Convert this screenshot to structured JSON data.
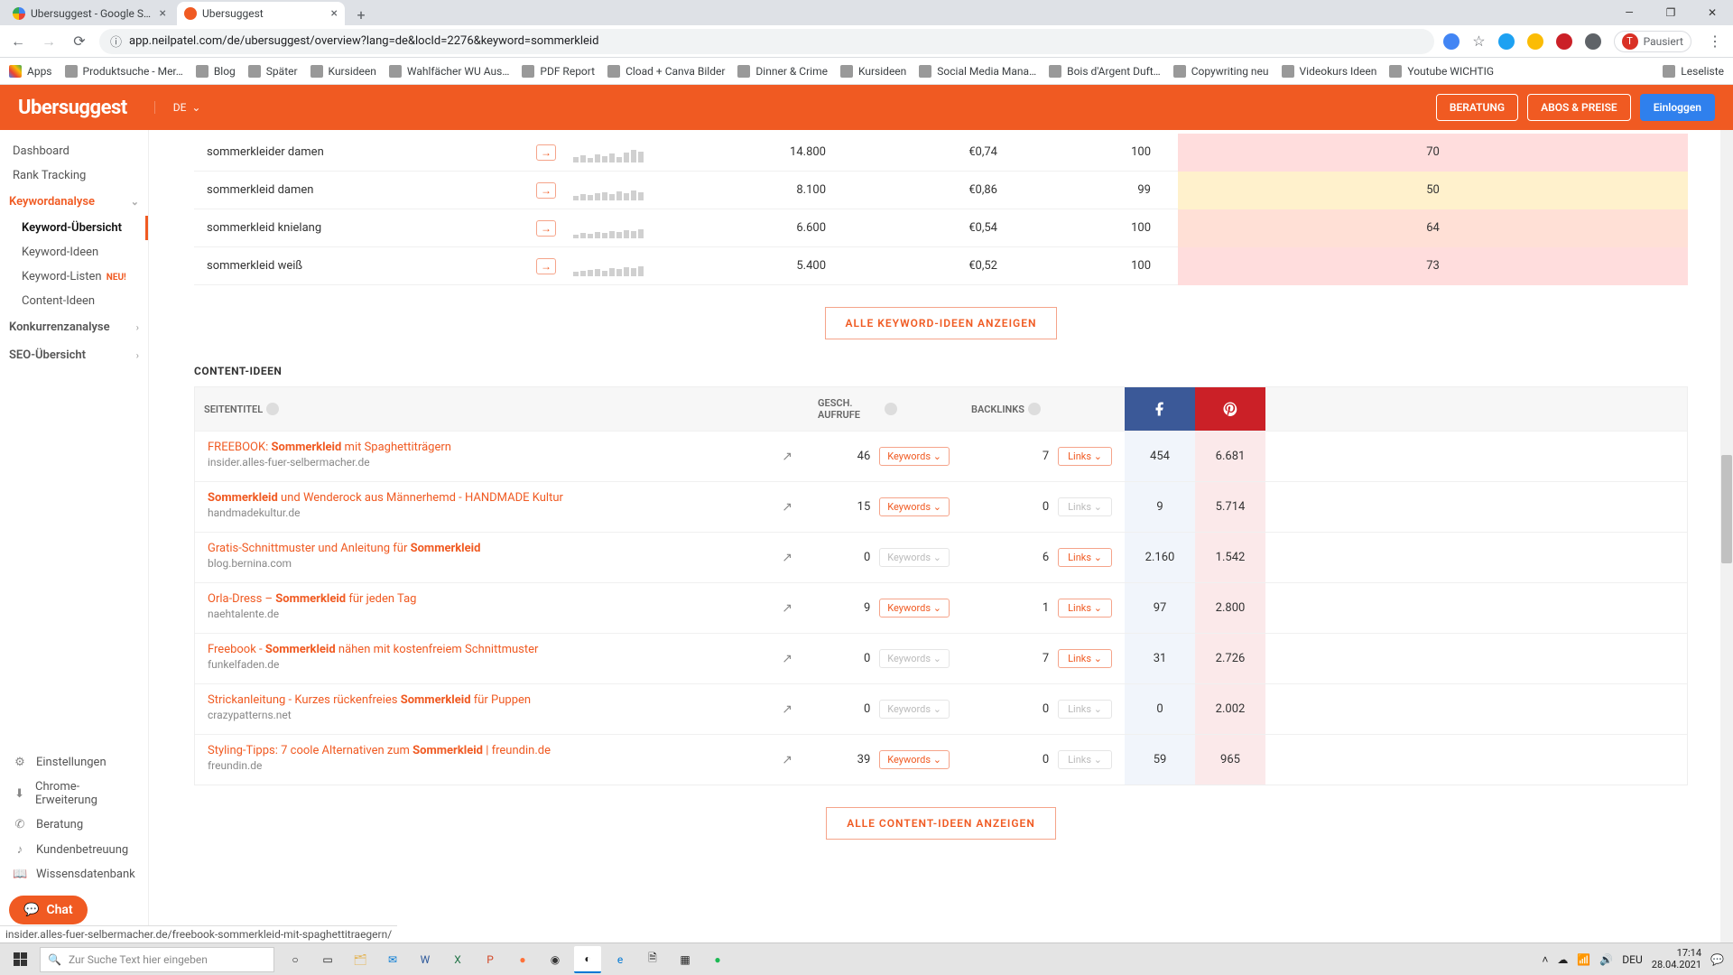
{
  "window": {
    "tabs": [
      {
        "title": "Ubersuggest - Google Suche"
      },
      {
        "title": "Ubersuggest"
      }
    ],
    "minimize": "—",
    "maximize": "❐",
    "close": "✕"
  },
  "address": {
    "lock": "ⓘ",
    "url": "app.neilpatel.com/de/ubersuggest/overview?lang=de&locId=2276&keyword=sommerkleid",
    "userpill": "Pausiert",
    "menu": "⋮"
  },
  "bookmarks": {
    "apps": "Apps",
    "items": [
      "Produktsuche - Mer…",
      "Blog",
      "Später",
      "Kursideen",
      "Wahlfächer WU Aus…",
      "PDF Report",
      "Cload + Canva Bilder",
      "Dinner & Crime",
      "Kursideen",
      "Social Media Mana…",
      "Bois d'Argent Duft…",
      "Copywriting neu",
      "Videokurs Ideen",
      "Youtube WICHTIG"
    ],
    "reading": "Leseliste"
  },
  "header": {
    "brand": "Ubersuggest",
    "lang": "DE",
    "consult": "BERATUNG",
    "plans": "ABOS & PREISE",
    "login": "Einloggen"
  },
  "sidebar": {
    "dashboard": "Dashboard",
    "rank": "Rank Tracking",
    "group_kw": "Keywordanalyse",
    "kw_overview": "Keyword-Übersicht",
    "kw_ideas": "Keyword-Ideen",
    "kw_lists": "Keyword-Listen",
    "kw_lists_tag": "NEU!",
    "content_ideas": "Content-Ideen",
    "group_comp": "Konkurrenzanalyse",
    "group_seo": "SEO-Übersicht",
    "settings": "Einstellungen",
    "chrome": "Chrome-Erweiterung",
    "consulting": "Beratung",
    "support": "Kundenbetreuung",
    "kb": "Wissensdatenbank",
    "chat": "Chat"
  },
  "keyword_ideas": {
    "rows": [
      {
        "kw": "sommerkleider damen",
        "vol": "14.800",
        "cpc": "€0,74",
        "pd": "100",
        "sd": "70",
        "sdclass": "sd-70"
      },
      {
        "kw": "sommerkleid damen",
        "vol": "8.100",
        "cpc": "€0,86",
        "pd": "99",
        "sd": "50",
        "sdclass": "sd-50"
      },
      {
        "kw": "sommerkleid knielang",
        "vol": "6.600",
        "cpc": "€0,54",
        "pd": "100",
        "sd": "64",
        "sdclass": "sd-64"
      },
      {
        "kw": "sommerkleid weiß",
        "vol": "5.400",
        "cpc": "€0,52",
        "pd": "100",
        "sd": "73",
        "sdclass": "sd-73"
      }
    ],
    "show_all": "ALLE KEYWORD-IDEEN ANZEIGEN"
  },
  "content_ideas": {
    "title": "CONTENT-IDEEN",
    "th_title": "SEITENTITEL",
    "th_visits": "GESCH. AUFRUFE",
    "th_backlinks": "BACKLINKS",
    "kw_label": "Keywords",
    "kw_chev": "⌄",
    "links_label": "Links",
    "links_chev": "⌄",
    "ext_icon": "↗",
    "rows": [
      {
        "pre": "FREEBOOK: ",
        "bold": "Sommerkleid",
        "post": " mit Spaghettiträgern",
        "domain": "insider.alles-fuer-selbermacher.de",
        "visits": "46",
        "kw_on": true,
        "backlinks": "7",
        "links_on": true,
        "fb": "454",
        "pin": "6.681"
      },
      {
        "pre": "",
        "bold": "Sommerkleid",
        "post": " und Wenderock aus Männerhemd - HANDMADE Kultur",
        "domain": "handmadekultur.de",
        "visits": "15",
        "kw_on": true,
        "backlinks": "0",
        "links_on": false,
        "fb": "9",
        "pin": "5.714"
      },
      {
        "pre": "Gratis-Schnittmuster und Anleitung für ",
        "bold": "Sommerkleid",
        "post": "",
        "domain": "blog.bernina.com",
        "visits": "0",
        "kw_on": false,
        "backlinks": "6",
        "links_on": true,
        "fb": "2.160",
        "pin": "1.542"
      },
      {
        "pre": "Orla-Dress – ",
        "bold": "Sommerkleid",
        "post": " für jeden Tag",
        "domain": "naehtalente.de",
        "visits": "9",
        "kw_on": true,
        "backlinks": "1",
        "links_on": true,
        "fb": "97",
        "pin": "2.800"
      },
      {
        "pre": "Freebook - ",
        "bold": "Sommerkleid",
        "post": " nähen mit kostenfreiem Schnittmuster",
        "domain": "funkelfaden.de",
        "visits": "0",
        "kw_on": false,
        "backlinks": "7",
        "links_on": true,
        "fb": "31",
        "pin": "2.726"
      },
      {
        "pre": "Strickanleitung - Kurzes rückenfreies ",
        "bold": "Sommerkleid",
        "post": " für Puppen",
        "domain": "crazypatterns.net",
        "visits": "0",
        "kw_on": false,
        "backlinks": "0",
        "links_on": false,
        "fb": "0",
        "pin": "2.002"
      },
      {
        "pre": "Styling-Tipps: 7 coole Alternativen zum ",
        "bold": "Sommerkleid",
        "post": " | freundin.de",
        "domain": "freundin.de",
        "visits": "39",
        "kw_on": true,
        "backlinks": "0",
        "links_on": false,
        "fb": "59",
        "pin": "965"
      }
    ],
    "show_all": "ALLE CONTENT-IDEEN ANZEIGEN"
  },
  "status_url": "insider.alles-fuer-selbermacher.de/freebook-sommerkleid-mit-spaghettitraegern/",
  "taskbar": {
    "search_placeholder": "Zur Suche Text hier eingeben",
    "lang": "DEU",
    "time": "17:14",
    "date": "28.04.2021"
  }
}
